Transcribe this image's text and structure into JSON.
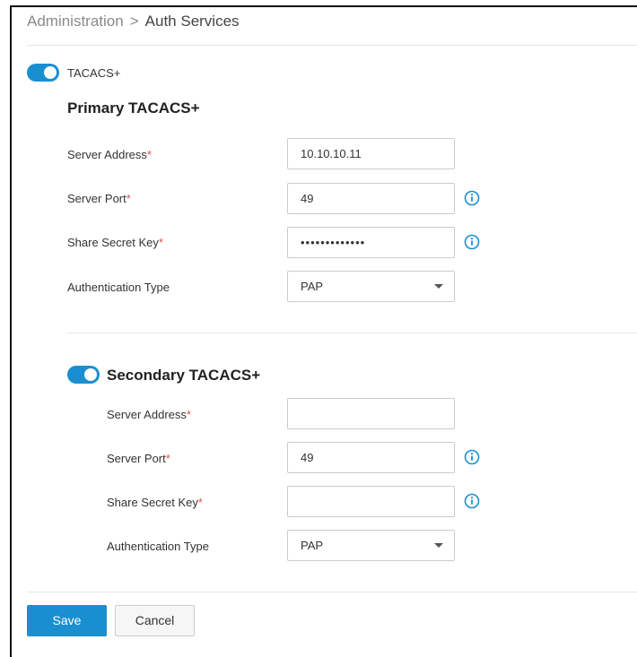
{
  "breadcrumb": {
    "parent": "Administration",
    "separator": ">",
    "current": "Auth Services"
  },
  "tacacs_toggle": {
    "label": "TACACS+",
    "enabled": true
  },
  "primary": {
    "title": "Primary TACACS+",
    "fields": {
      "server_address": {
        "label": "Server Address",
        "required_mark": "*",
        "value": "10.10.10.11"
      },
      "server_port": {
        "label": "Server Port",
        "required_mark": "*",
        "value": "49"
      },
      "secret_key": {
        "label": "Share Secret Key",
        "required_mark": "*",
        "value": "•••••••••••••"
      },
      "auth_type": {
        "label": "Authentication Type",
        "value": "PAP"
      }
    }
  },
  "secondary": {
    "title": "Secondary TACACS+",
    "enabled": true,
    "fields": {
      "server_address": {
        "label": "Server Address",
        "required_mark": "*",
        "value": ""
      },
      "server_port": {
        "label": "Server Port",
        "required_mark": "*",
        "value": "49"
      },
      "secret_key": {
        "label": "Share Secret Key",
        "required_mark": "*",
        "value": ""
      },
      "auth_type": {
        "label": "Authentication Type",
        "value": "PAP"
      }
    }
  },
  "icons": {
    "info": "info-icon",
    "dropdown": "chevron-down-icon"
  },
  "colors": {
    "accent": "#1a8fd0",
    "required": "#d9534f"
  },
  "actions": {
    "save_label": "Save",
    "cancel_label": "Cancel"
  }
}
